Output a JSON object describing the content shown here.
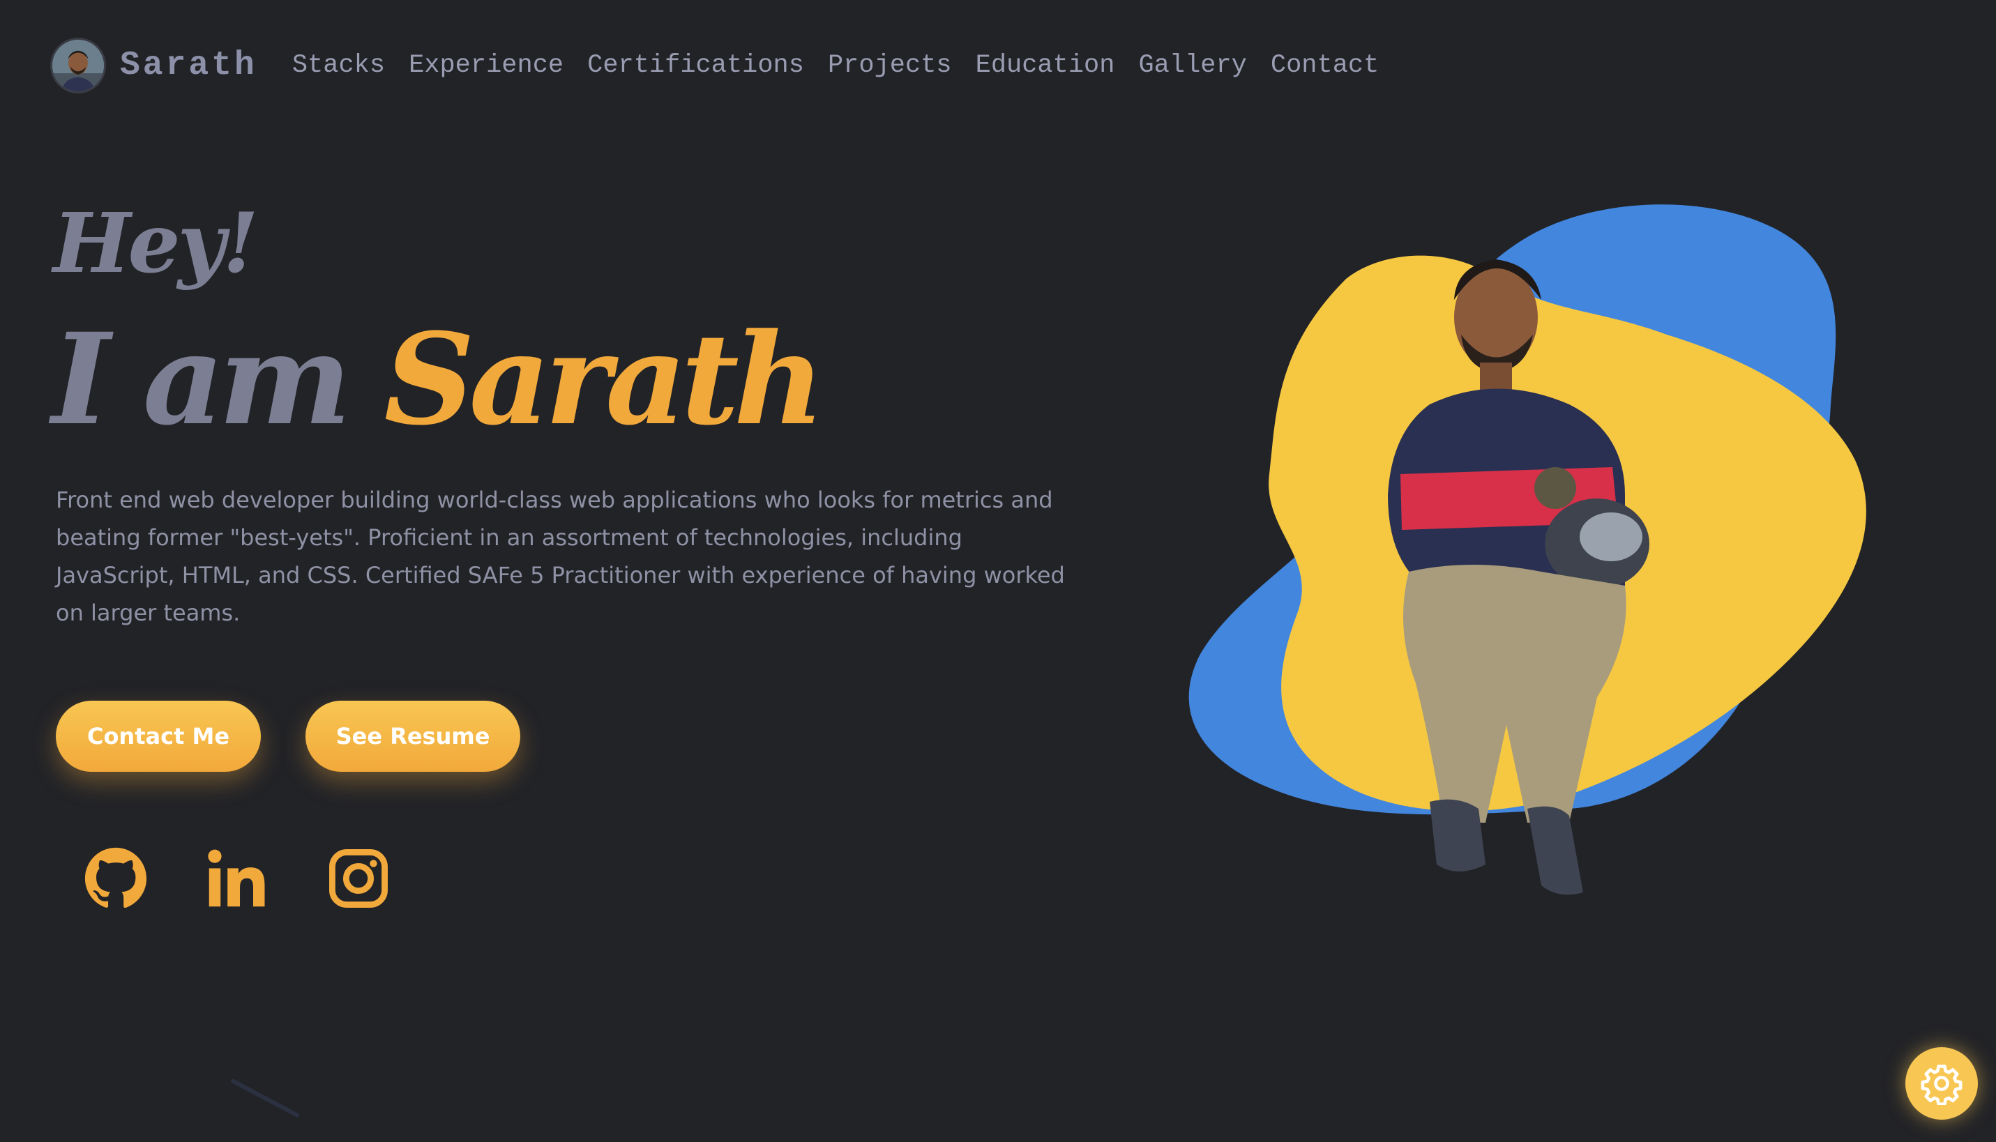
{
  "header": {
    "brand": "Sarath",
    "nav": [
      {
        "label": "Stacks"
      },
      {
        "label": "Experience"
      },
      {
        "label": "Certifications"
      },
      {
        "label": "Projects"
      },
      {
        "label": "Education"
      },
      {
        "label": "Gallery"
      },
      {
        "label": "Contact"
      }
    ]
  },
  "hero": {
    "greeting": "Hey!",
    "intro_prefix": "I am",
    "intro_name": "Sarath",
    "bio": "Front end web developer building world-class web applications who looks for metrics and beating former \"best-yets\". Proficient in an assortment of technologies, including JavaScript, HTML, and CSS. Certified SAFe 5 Practitioner with experience of having worked on larger teams.",
    "buttons": {
      "contact_label": "Contact Me",
      "resume_label": "See Resume"
    },
    "social": [
      {
        "icon": "github-icon"
      },
      {
        "icon": "linkedin-icon"
      },
      {
        "icon": "instagram-icon"
      }
    ]
  },
  "portrait": {
    "blob_colors": [
      "#4286dd",
      "#f6c842"
    ]
  },
  "settings": {
    "icon": "gear-icon"
  },
  "colors": {
    "background": "#222327",
    "accent": "#f2a93b",
    "muted": "#7c7f94",
    "text": "#8f91a5"
  }
}
